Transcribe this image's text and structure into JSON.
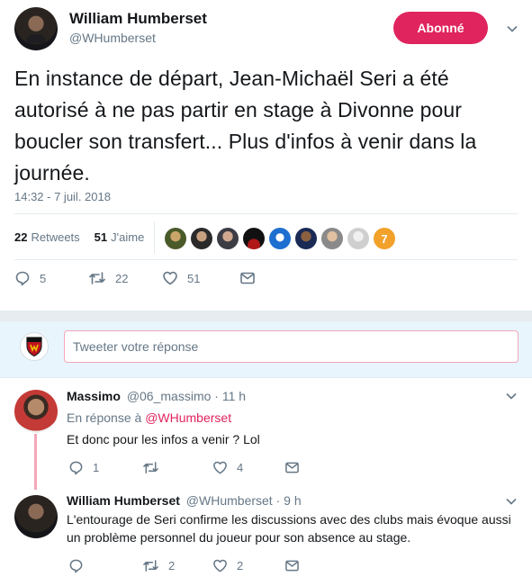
{
  "tweet": {
    "author_name": "William Humberset",
    "author_handle": "@WHumberset",
    "follow_label": "Abonné",
    "text": "En instance de départ, Jean-Michaël Seri a été autorisé à ne pas partir en stage à Divonne pour boucler son transfert... Plus d'infos à venir dans la journée.",
    "timestamp": "14:32 - 7 juil. 2018",
    "retweets_count": "22",
    "retweets_label": "Retweets",
    "likes_count": "51",
    "likes_label": "J'aime",
    "actions": {
      "replies": "5",
      "retweets": "22",
      "likes": "51"
    },
    "liker_avatars": [
      "liker-avatar-1",
      "liker-avatar-2",
      "liker-avatar-3",
      "liker-avatar-4",
      "liker-avatar-5",
      "liker-avatar-6",
      "liker-avatar-7",
      "liker-avatar-8",
      "liker-avatar-9"
    ],
    "liker_last_label": "7"
  },
  "reply_box": {
    "placeholder": "Tweeter votre réponse"
  },
  "replies": [
    {
      "name": "Massimo",
      "handle": "@06_massimo",
      "time": "· 11 h",
      "in_reply_prefix": "En réponse à",
      "in_reply_to": "@WHumberset",
      "text": "Et donc pour les infos a venir ? Lol",
      "actions": {
        "replies": "1",
        "retweets": "",
        "likes": "4"
      }
    },
    {
      "name": "William Humberset",
      "handle": "@WHumberset",
      "time": "· 9 h",
      "text": "L'entourage de Seri confirme les discussions avec des clubs mais évoque aussi un problème personnel du joueur pour son absence au stage.",
      "actions": {
        "replies": "",
        "retweets": "2",
        "likes": "2"
      }
    }
  ],
  "colors": {
    "accent": "#e0245e",
    "text_secondary": "#657786",
    "reply_box_bg": "#e8f5fd"
  }
}
